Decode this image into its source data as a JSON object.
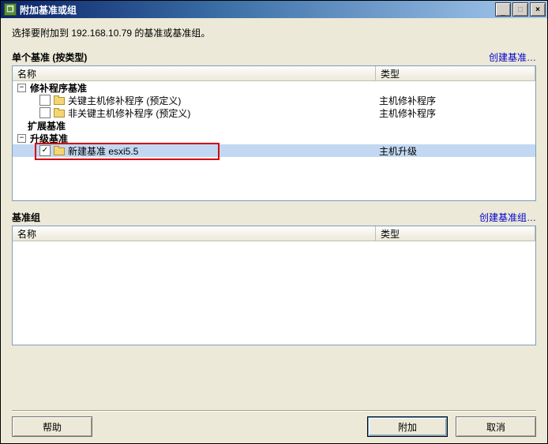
{
  "titlebar": {
    "title": "附加基准或组"
  },
  "win_buttons": {
    "minimize": "_",
    "maximize": "□",
    "close": "×"
  },
  "instruction": "选择要附加到 192.168.10.79 的基准或基准组。",
  "section1": {
    "title": "单个基准 (按类型)",
    "link": "创建基准…",
    "col_name": "名称",
    "col_type": "类型"
  },
  "tree": {
    "group1": {
      "toggle": "−",
      "label": "修补程序基准"
    },
    "item1": {
      "label": "关键主机修补程序 (预定义)",
      "type": "主机修补程序",
      "checked": ""
    },
    "item2": {
      "label": "非关键主机修补程序 (预定义)",
      "type": "主机修补程序",
      "checked": ""
    },
    "group2": {
      "label": "扩展基准"
    },
    "group3": {
      "toggle": "−",
      "label": "升级基准"
    },
    "item3": {
      "label": "新建基准 esxi5.5",
      "type": "主机升级",
      "checked": "✓"
    }
  },
  "section2": {
    "title": "基准组",
    "link": "创建基准组…",
    "col_name": "名称",
    "col_type": "类型"
  },
  "buttons": {
    "help": "帮助",
    "attach": "附加",
    "cancel": "取消"
  }
}
